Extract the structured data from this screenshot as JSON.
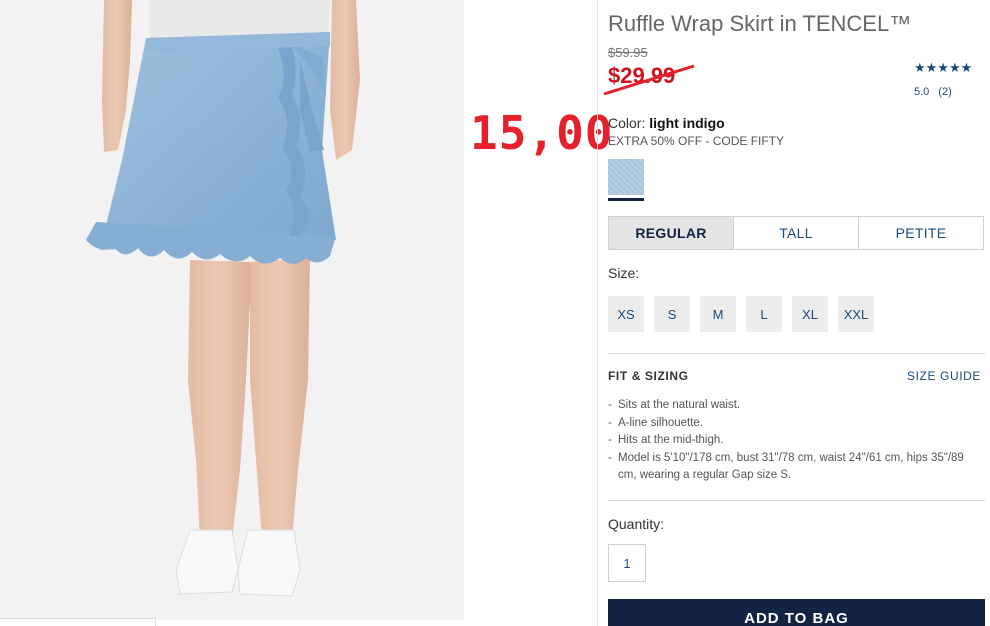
{
  "product": {
    "title": "Ruffle Wrap Skirt in TENCEL™",
    "original_price": "$59.95",
    "sale_price": "$29.99",
    "overlay_price": "15,00",
    "rating": {
      "stars": "★★★★★",
      "value": "5.0",
      "count": "(2)"
    },
    "color_label": "Color:",
    "color_name": "light indigo",
    "promo": "EXTRA 50% OFF - CODE FIFTY"
  },
  "fit_tabs": [
    {
      "label": "REGULAR",
      "active": true
    },
    {
      "label": "TALL",
      "active": false
    },
    {
      "label": "PETITE",
      "active": false
    }
  ],
  "sizes": {
    "label": "Size:",
    "options": [
      "XS",
      "S",
      "M",
      "L",
      "XL",
      "XXL"
    ]
  },
  "fit_sizing": {
    "heading": "FIT & SIZING",
    "guide_link": "SIZE GUIDE",
    "bullets": [
      "Sits at the natural waist.",
      "A-line silhouette.",
      "Hits at the mid-thigh.",
      "Model is 5'10\"/178 cm, bust 31\"/78 cm, waist 24\"/61 cm, hips 35\"/89 cm, wearing a regular Gap size S."
    ]
  },
  "quantity": {
    "label": "Quantity:",
    "value": "1"
  },
  "cart": {
    "add_label": "ADD TO BAG"
  },
  "colors": {
    "brand_navy": "#122344",
    "link_blue": "#1a4a7a",
    "sale_red": "#d0121a",
    "swatch": "#a7c6de"
  }
}
